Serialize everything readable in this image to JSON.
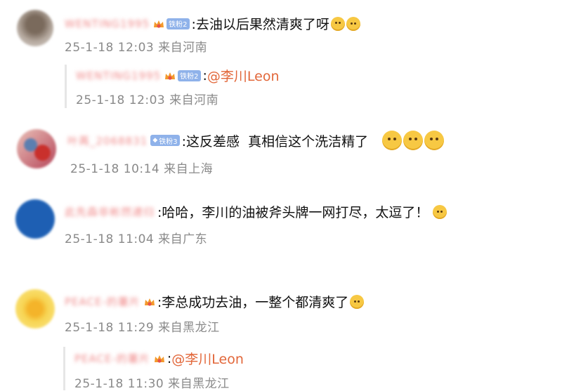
{
  "comments": [
    {
      "username": "WENTING1995",
      "badge": "铁粉2",
      "text": ":去油以后果然清爽了呀",
      "time": "25-1-18 12:03",
      "location": "来自河南",
      "reply": {
        "username": "WENTING1995",
        "badge": "铁粉2",
        "prefix": ":",
        "mention": "@李川Leon",
        "time": "25-1-18 12:03",
        "location": "来自河南"
      }
    },
    {
      "username": "叶苒_2068831",
      "badge": "铁粉3",
      "text": ":这反差感  真相信这个洗洁精了",
      "time": "25-1-18 10:14",
      "location": "来自上海"
    },
    {
      "username": "此先森非彬然递归",
      "text": ":哈哈，李川的油被斧头牌一网打尽，太逗了！",
      "time": "25-1-18 11:04",
      "location": "来自广东"
    },
    {
      "username": "PEACE-的薯片",
      "text": ":李总成功去油，一整个都清爽了",
      "time": "25-1-18 11:29",
      "location": "来自黑龙江",
      "reply": {
        "username": "PEACE-的薯片",
        "prefix": ":",
        "mention": "@李川Leon",
        "time": "25-1-18 11:30",
        "location": "来自黑龙江"
      }
    }
  ],
  "colors": {
    "username": "#f08a8a",
    "mention": "#e2673a",
    "meta": "#8a8a8a",
    "badge": "#8fb2ea"
  },
  "icons": [
    "crown-icon",
    "fan-badge",
    "smile-emoji",
    "cat-emoji",
    "heart-eyes-emoji"
  ]
}
